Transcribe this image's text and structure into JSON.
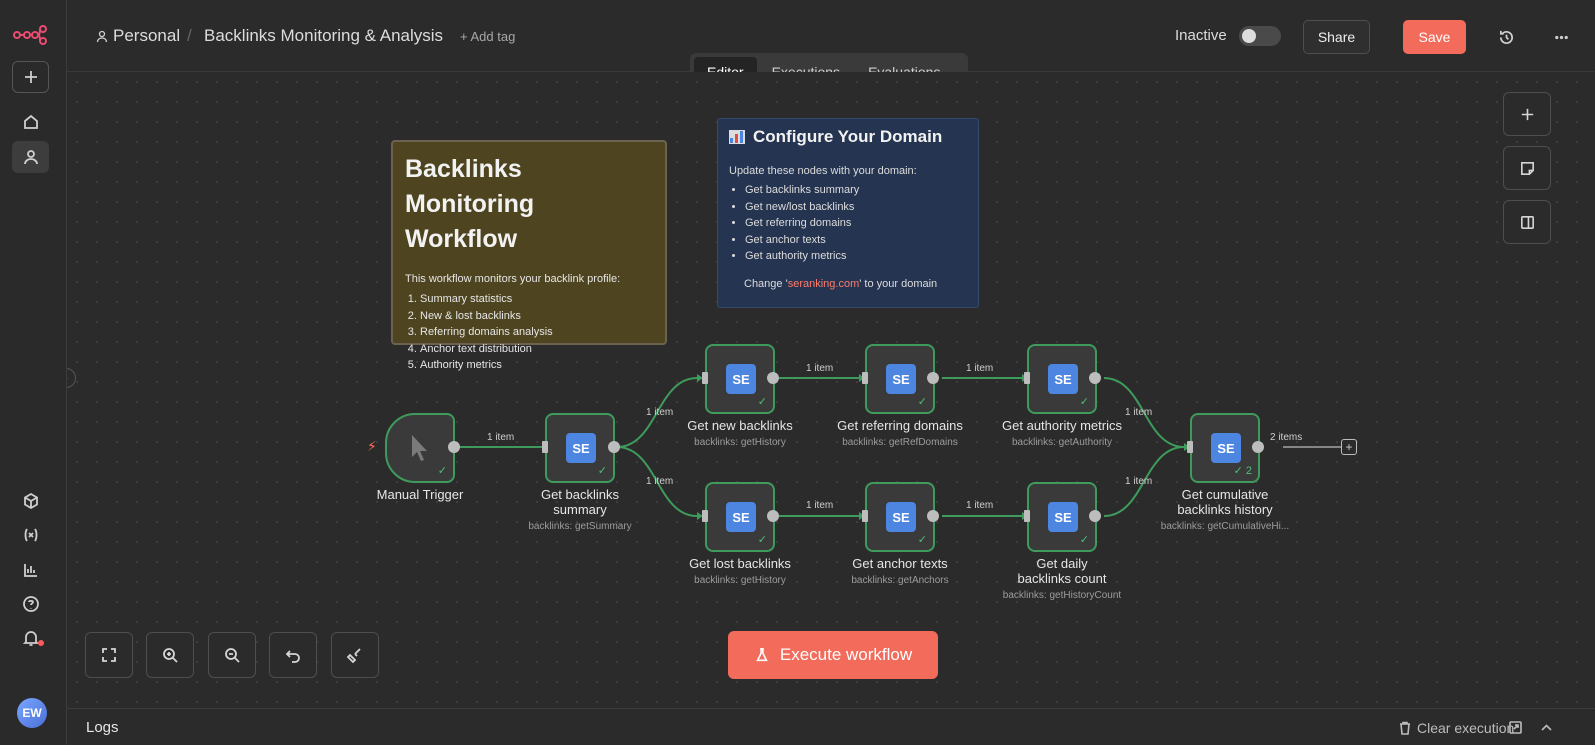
{
  "header": {
    "project": "Personal",
    "separator": "/",
    "workflow_name": "Backlinks Monitoring & Analysis",
    "add_tag": "+ Add tag",
    "status_label": "Inactive",
    "share_label": "Share",
    "save_label": "Save"
  },
  "tabs": [
    {
      "label": "Editor",
      "active": true
    },
    {
      "label": "Executions",
      "active": false
    },
    {
      "label": "Evaluations",
      "active": false
    }
  ],
  "notes": {
    "overview": {
      "title": "Backlinks Monitoring Workflow",
      "intro": "This workflow monitors your backlink profile:",
      "items": [
        "Summary statistics",
        "New & lost backlinks",
        "Referring domains analysis",
        "Anchor text distribution",
        "Authority metrics"
      ]
    },
    "configure": {
      "title": "Configure Your Domain",
      "intro": "Update these nodes with your domain:",
      "items": [
        "Get backlinks summary",
        "Get new/lost backlinks",
        "Get referring domains",
        "Get anchor texts",
        "Get authority metrics"
      ],
      "change_prefix": "Change '",
      "change_domain": "seranking.com",
      "change_suffix": "' to your domain"
    }
  },
  "nodes": {
    "trigger": {
      "label": "Manual Trigger"
    },
    "summary": {
      "icon": "SE",
      "label": "Get backlinks summary",
      "sub": "backlinks: getSummary"
    },
    "new": {
      "icon": "SE",
      "label": "Get new backlinks",
      "sub": "backlinks: getHistory"
    },
    "refdomains": {
      "icon": "SE",
      "label": "Get referring domains",
      "sub": "backlinks: getRefDomains"
    },
    "authority": {
      "icon": "SE",
      "label": "Get authority metrics",
      "sub": "backlinks: getAuthority"
    },
    "lost": {
      "icon": "SE",
      "label": "Get lost backlinks",
      "sub": "backlinks: getHistory"
    },
    "anchors": {
      "icon": "SE",
      "label": "Get anchor texts",
      "sub": "backlinks: getAnchors"
    },
    "daily": {
      "icon": "SE",
      "label": "Get daily backlinks count",
      "sub": "backlinks: getHistoryCount"
    },
    "cumulative": {
      "icon": "SE",
      "label": "Get cumulative backlinks history",
      "sub": "backlinks: getCumulativeHi...",
      "count": "2"
    }
  },
  "connections": {
    "one_item": "1 item",
    "two_items": "2 items"
  },
  "execute_label": "Execute workflow",
  "logs": {
    "title": "Logs",
    "clear_label": "Clear execution"
  },
  "user": {
    "initials": "EW"
  },
  "colors": {
    "accent": "#f26b5b",
    "node_border": "#3e9b5c",
    "node_icon": "#4d86e0",
    "note_yellow": "#4e4520",
    "note_blue": "#253450"
  }
}
